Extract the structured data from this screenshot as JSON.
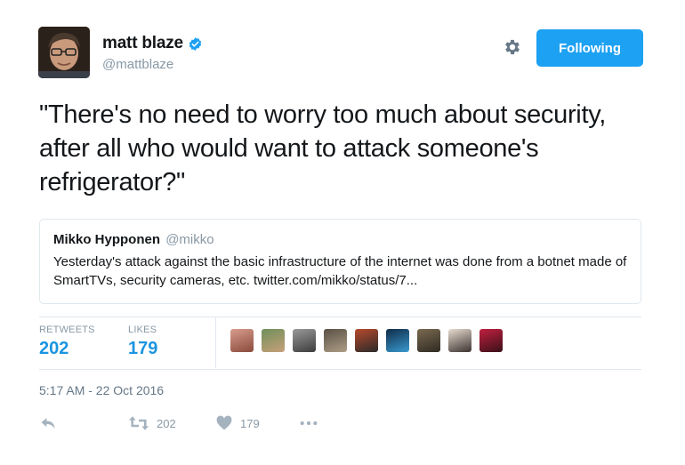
{
  "author": {
    "display_name": "matt blaze",
    "handle": "@mattblaze",
    "verified_icon": "verified-badge-icon"
  },
  "header": {
    "settings_icon": "gear-icon",
    "follow_button_label": "Following"
  },
  "tweet": {
    "text": "\"There's no need to worry too much about security, after all who would want to attack someone's refrigerator?\""
  },
  "quoted_tweet": {
    "author_name": "Mikko Hypponen",
    "author_handle": "@mikko",
    "text": "Yesterday's attack against the basic infrastructure of the internet was done from a botnet made of SmartTVs, security cameras, etc. twitter.com/mikko/status/7..."
  },
  "stats": {
    "retweets_label": "RETWEETS",
    "retweets_value": "202",
    "likes_label": "LIKES",
    "likes_value": "179",
    "facepile_count": 9
  },
  "timestamp": "5:17 AM - 22 Oct 2016",
  "actions": {
    "reply_icon": "reply-icon",
    "retweet_icon": "retweet-icon",
    "retweet_count": "202",
    "like_icon": "heart-icon",
    "like_count": "179",
    "more_icon": "more-dots-icon"
  },
  "colors": {
    "accent": "#1da1f2",
    "link_blue": "#1b95e0",
    "muted": "#8899a6",
    "border": "#e1e8ed"
  }
}
